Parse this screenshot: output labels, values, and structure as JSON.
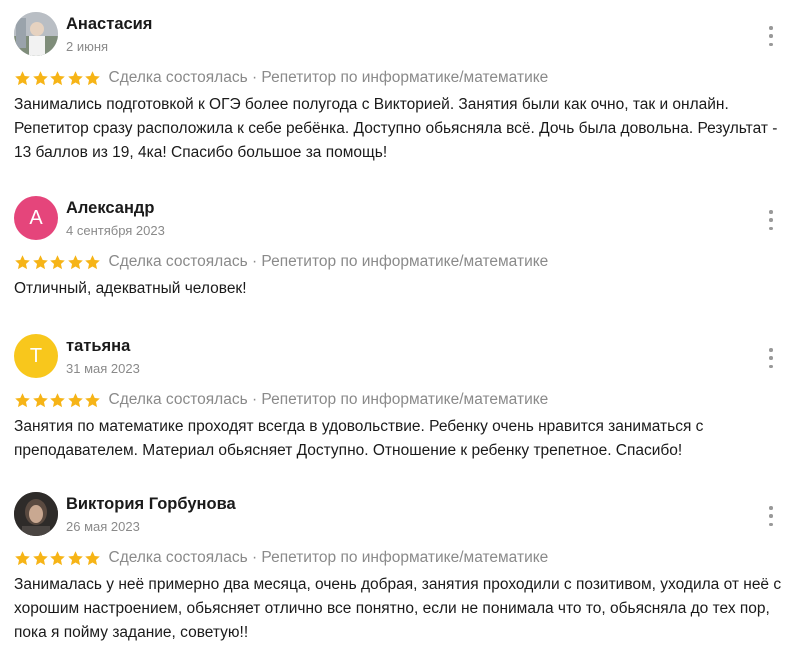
{
  "star_color": "#f6b417",
  "icons": {
    "rating": "star-icon",
    "menu": "more-vertical-icon"
  },
  "reviews": [
    {
      "author": "Анастасия",
      "date": "2 июня",
      "avatar_type": "photo",
      "rating": 5,
      "meta": "Сделка состоялась · Репетитор по информатике/математике",
      "text": "Занимались подготовкой к ОГЭ более полугода с Викторией. Занятия были как очно, так и онлайн. Репетитор сразу расположила к себе ребёнка. Доступно обьясняла всё. Дочь была довольна. Результат - 13 баллов из 19, 4ка! Спасибо большое за помощь!"
    },
    {
      "author": "Александр",
      "date": "4 сентября 2023",
      "avatar_letter": "А",
      "avatar_color": "#e5457b",
      "rating": 5,
      "meta": "Сделка состоялась · Репетитор по информатике/математике",
      "text": "Отличный, адекватный человек!"
    },
    {
      "author": "татьяна",
      "date": "31 мая 2023",
      "avatar_letter": "Т",
      "avatar_color": "#f8c71c",
      "rating": 5,
      "meta": "Сделка состоялась · Репетитор по информатике/математике",
      "text": "Занятия по математике проходят всегда в удовольствие. Ребенку очень нравится заниматься с преподавателем. Материал обьясняет Доступно. Отношение к ребенку трепетное. Спасибо!"
    },
    {
      "author": "Виктория Горбунова",
      "date": "26 мая 2023",
      "avatar_type": "photo",
      "rating": 5,
      "meta": "Сделка состоялась · Репетитор по информатике/математике",
      "text": "Занималась у неё примерно два месяца, очень добрая, занятия проходили с позитивом, уходила от неё с хорошим настроением, обьясняет отлично все понятно, если не понимала что то, обьясняла до тех пор, пока я пойму задание, советую!!"
    }
  ]
}
